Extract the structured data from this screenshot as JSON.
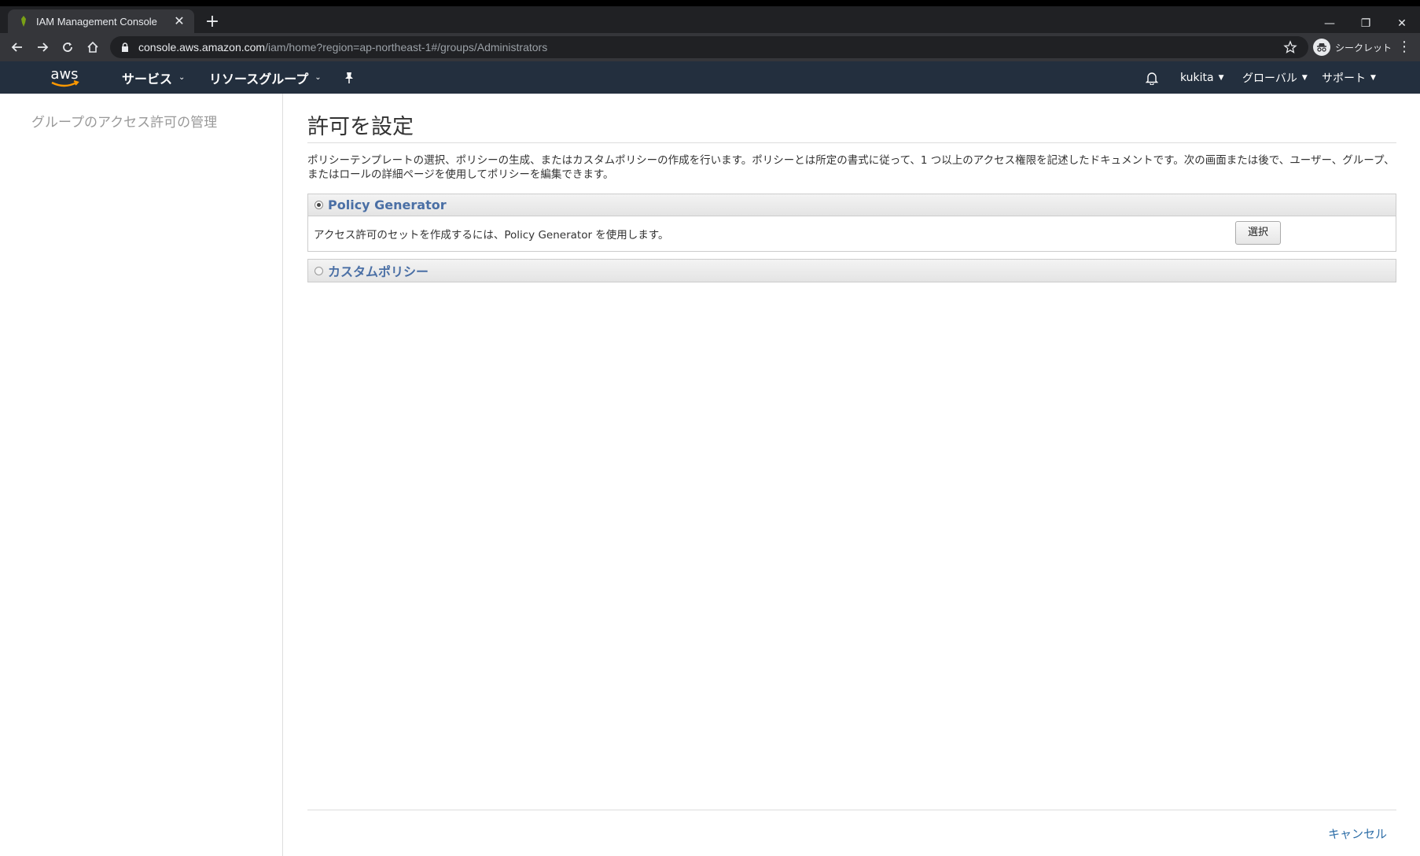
{
  "browser": {
    "tab_title": "IAM Management Console",
    "tab_close": "✕",
    "new_tab": "+",
    "url_host": "console.aws.amazon.com",
    "url_path": "/iam/home?region=ap-northeast-1#/groups/Administrators",
    "incognito_label": "シークレット",
    "window_minimize": "—",
    "window_restore": "❐",
    "window_close": "✕"
  },
  "aws_nav": {
    "logo": "aws",
    "services": "サービス",
    "resource_groups": "リソースグループ",
    "account": "kukita",
    "region": "グローバル",
    "support": "サポート"
  },
  "sidebar": {
    "title": "グループのアクセス許可の管理"
  },
  "main": {
    "heading": "許可を設定",
    "description": "ポリシーテンプレートの選択、ポリシーの生成、またはカスタムポリシーの作成を行います。ポリシーとは所定の書式に従って、1 つ以上のアクセス権限を記述したドキュメントです。次の画面または後で、ユーザー、グループ、またはロールの詳細ページを使用してポリシーを編集できます。",
    "options": [
      {
        "label": "Policy Generator",
        "selected": true,
        "body": "アクセス許可のセットを作成するには、Policy Generator を使用します。",
        "button": "選択"
      },
      {
        "label": "カスタムポリシー",
        "selected": false
      }
    ],
    "cancel": "キャンセル"
  }
}
